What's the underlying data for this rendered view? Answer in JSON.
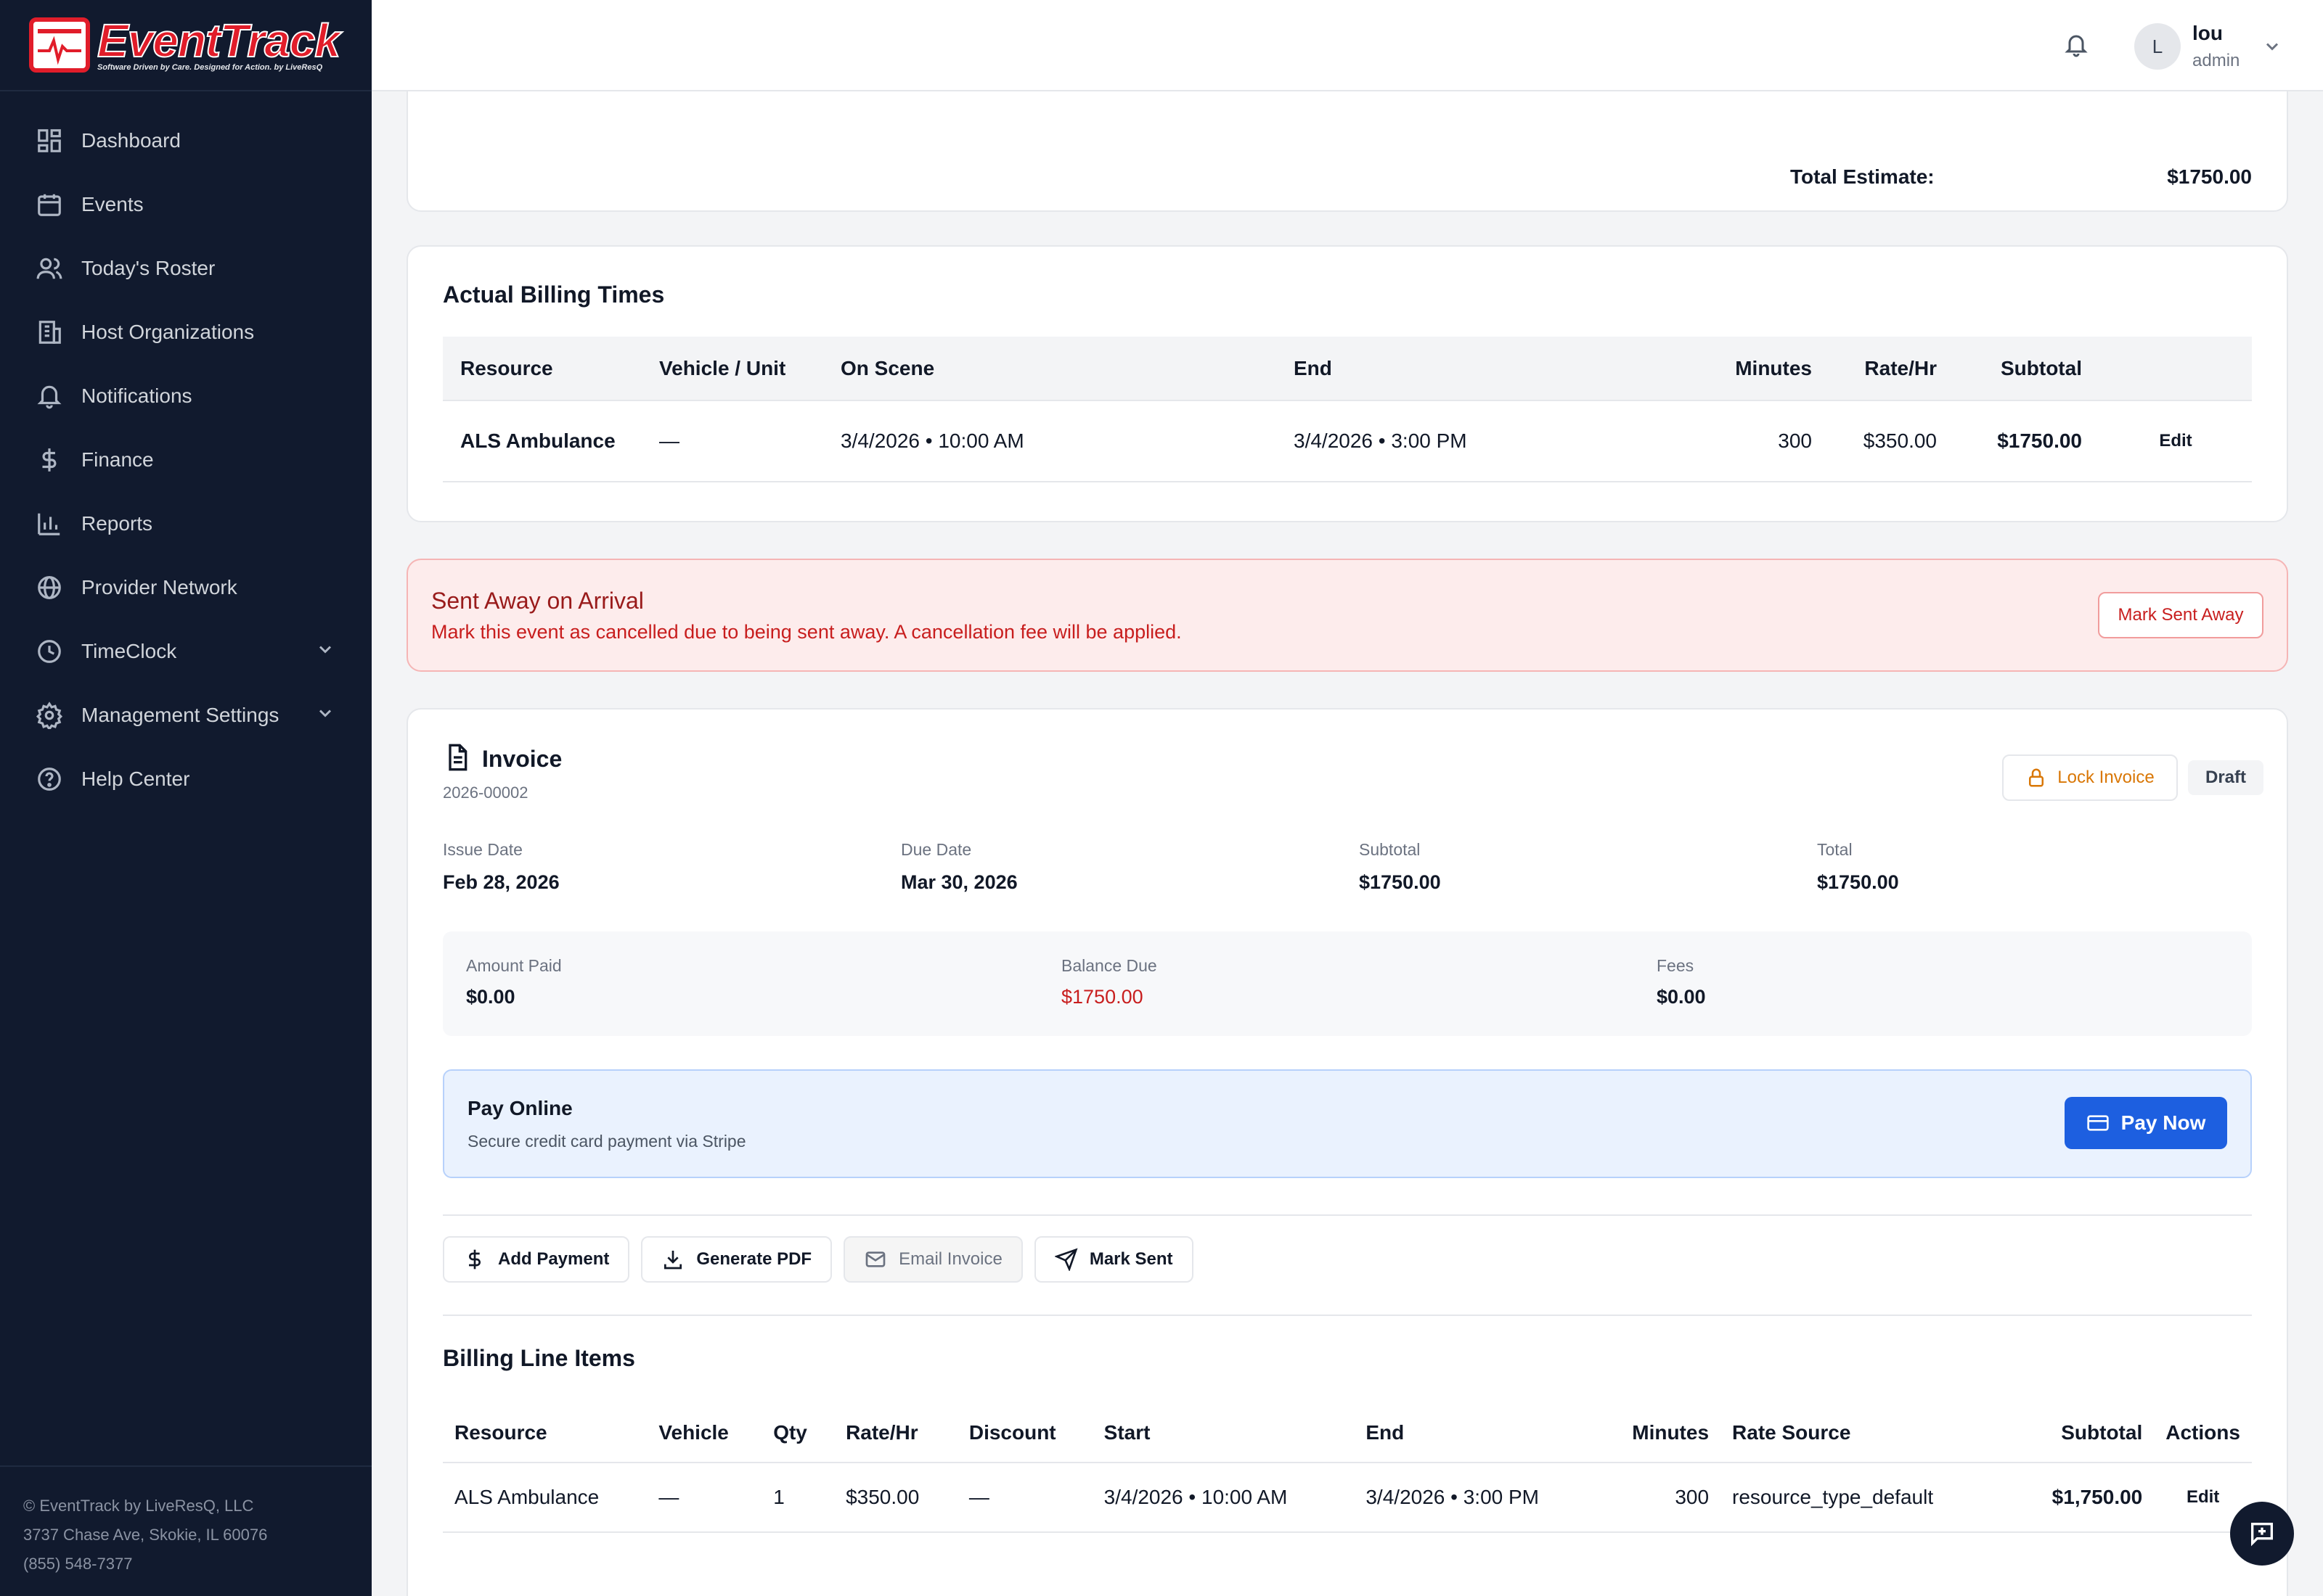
{
  "brand": {
    "name": "EventTrack",
    "tagline": "Software Driven by Care. Designed for Action.",
    "by": "by LiveResQ"
  },
  "sidebar": {
    "items": [
      {
        "label": "Dashboard",
        "icon": "dashboard-icon"
      },
      {
        "label": "Events",
        "icon": "calendar-icon"
      },
      {
        "label": "Today's Roster",
        "icon": "users-icon"
      },
      {
        "label": "Host Organizations",
        "icon": "building-icon"
      },
      {
        "label": "Notifications",
        "icon": "bell-icon"
      },
      {
        "label": "Finance",
        "icon": "dollar-icon"
      },
      {
        "label": "Reports",
        "icon": "bar-chart-icon"
      },
      {
        "label": "Provider Network",
        "icon": "globe-icon"
      },
      {
        "label": "TimeClock",
        "icon": "clock-icon"
      },
      {
        "label": "Management Settings",
        "icon": "gear-icon"
      },
      {
        "label": "Help Center",
        "icon": "help-icon"
      }
    ],
    "footer": {
      "copyright": "© EventTrack by LiveResQ, LLC",
      "address": "3737 Chase Ave, Skokie, IL 60076",
      "phone": "(855) 548-7377"
    }
  },
  "header": {
    "user_initial": "L",
    "user_name": "lou",
    "user_role": "admin"
  },
  "estimate": {
    "label": "Total Estimate:",
    "value": "$1750.00"
  },
  "actual_billing": {
    "title": "Actual Billing Times",
    "columns": [
      "Resource",
      "Vehicle / Unit",
      "On Scene",
      "End",
      "Minutes",
      "Rate/Hr",
      "Subtotal"
    ],
    "rows": [
      {
        "resource": "ALS Ambulance",
        "vehicle": "—",
        "on_scene": "3/4/2026 • 10:00 AM",
        "end": "3/4/2026 • 3:00 PM",
        "minutes": "300",
        "rate": "$350.00",
        "subtotal": "$1750.00",
        "action": "Edit"
      }
    ]
  },
  "sent_away": {
    "title": "Sent Away on Arrival",
    "description": "Mark this event as cancelled due to being sent away. A cancellation fee will be applied.",
    "button": "Mark Sent Away"
  },
  "invoice": {
    "title": "Invoice",
    "number": "2026-00002",
    "lock_button": "Lock Invoice",
    "status": "Draft",
    "issue_date_label": "Issue Date",
    "issue_date": "Feb 28, 2026",
    "due_date_label": "Due Date",
    "due_date": "Mar 30, 2026",
    "subtotal_label": "Subtotal",
    "subtotal": "$1750.00",
    "total_label": "Total",
    "total": "$1750.00",
    "amount_paid_label": "Amount Paid",
    "amount_paid": "$0.00",
    "balance_due_label": "Balance Due",
    "balance_due": "$1750.00",
    "fees_label": "Fees",
    "fees": "$0.00",
    "pay_online_title": "Pay Online",
    "pay_online_sub": "Secure credit card payment via Stripe",
    "pay_now": "Pay Now",
    "actions": {
      "add_payment": "Add Payment",
      "generate_pdf": "Generate PDF",
      "email_invoice": "Email Invoice",
      "mark_sent": "Mark Sent"
    }
  },
  "line_items": {
    "title": "Billing Line Items",
    "columns": [
      "Resource",
      "Vehicle",
      "Qty",
      "Rate/Hr",
      "Discount",
      "Start",
      "End",
      "Minutes",
      "Rate Source",
      "Subtotal",
      "Actions"
    ],
    "rows": [
      {
        "resource": "ALS Ambulance",
        "vehicle": "—",
        "qty": "1",
        "rate": "$350.00",
        "discount": "—",
        "start": "3/4/2026 • 10:00 AM",
        "end": "3/4/2026 • 3:00 PM",
        "minutes": "300",
        "rate_source": "resource_type_default",
        "subtotal": "$1,750.00",
        "action": "Edit"
      }
    ]
  },
  "colors": {
    "sidebar_bg": "#111a2e",
    "brand_red": "#e11d2a",
    "primary_blue": "#1d5fe0",
    "alert_bg": "#fdecec",
    "warning_orange": "#d97706"
  }
}
